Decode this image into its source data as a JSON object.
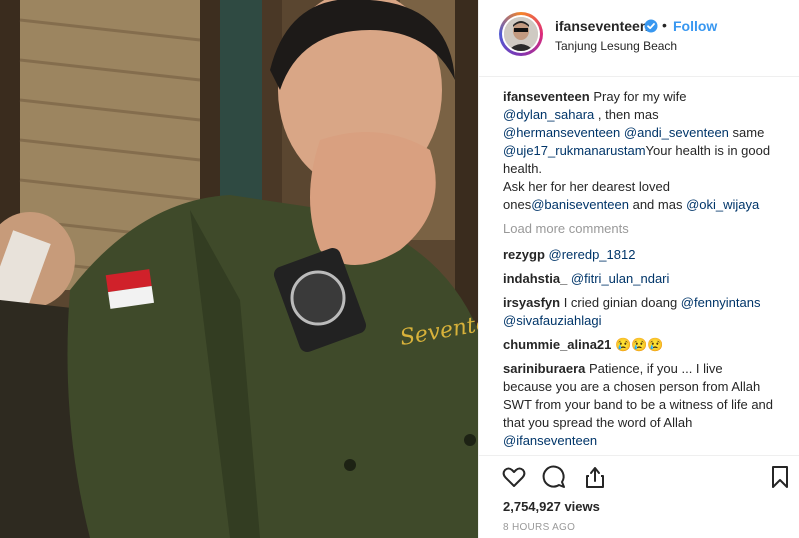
{
  "post": {
    "username": "ifanseventeen",
    "follow_label": "Follow",
    "dot": "•",
    "location": "Tanjung Lesung Beach"
  },
  "caption": {
    "username": "ifanseventeen",
    "t1": " Pray for my wife ",
    "m1": "@dylan_sahara",
    "t2": " , then mas ",
    "m2": "@hermanseventeen",
    "t3": " ",
    "m3": "@andi_seventeen",
    "t4": " same ",
    "m4": "@uje17_rukmanarustam",
    "t5": "Your health is in good health.",
    "t6": "Ask her for her dearest loved ones",
    "m5": "@baniseventeen",
    "t7": " and mas ",
    "m6": "@oki_wijaya"
  },
  "load_more": "Load more comments",
  "comments": [
    {
      "user": "rezygp",
      "text": "",
      "mention": "@reredp_1812",
      "mention2": "",
      "text2": ""
    },
    {
      "user": "indahstia_",
      "text": "",
      "mention": "@fitri_ulan_ndari",
      "mention2": "",
      "text2": ""
    },
    {
      "user": "irsyasfyn",
      "text": " I cried ginian doang ",
      "mention": "@fennyintans",
      "mention2": "@sivafauziahlagi",
      "text2": " "
    },
    {
      "user": "chummie_alina21",
      "text": " 😢😢😢",
      "mention": "",
      "mention2": "",
      "text2": ""
    },
    {
      "user": "sariniburaera",
      "text": " Patience, if you ... I live because you are a chosen person from Allah SWT from your band to be a witness of life and that you spread the word of Allah ",
      "mention": "@ifanseventeen",
      "mention2": "",
      "text2": ""
    }
  ],
  "icons": {
    "like": "heart-icon",
    "comment": "comment-icon",
    "share": "share-icon",
    "save": "bookmark-icon",
    "verified": "verified-badge-icon"
  },
  "stats": {
    "views": "2,754,927 views",
    "time": "8 HOURS AGO"
  },
  "colors": {
    "link": "#003569",
    "follow": "#3897f0",
    "verified": "#3897f0",
    "muted": "#999999"
  }
}
